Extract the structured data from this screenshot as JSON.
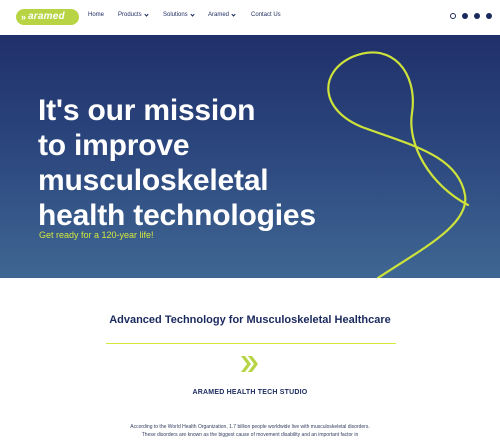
{
  "logo": {
    "text": "aramed",
    "chevrons": "»"
  },
  "nav": {
    "items": [
      {
        "label": "Home",
        "has_dropdown": false
      },
      {
        "label": "Products",
        "has_dropdown": true
      },
      {
        "label": "Solutions",
        "has_dropdown": true
      },
      {
        "label": "Aramed",
        "has_dropdown": true
      },
      {
        "label": "Contact Us",
        "has_dropdown": false
      }
    ],
    "icons": [
      "globe-icon",
      "facebook-icon",
      "linkedin-icon",
      "instagram-icon"
    ]
  },
  "hero": {
    "title_lines": [
      "It's our mission",
      "to improve",
      "musculoskeletal",
      "health technologies"
    ],
    "subtitle": "Get ready for a 120-year life!",
    "accent_color": "#d4e83c"
  },
  "main": {
    "section_title": "Advanced Technology for Musculoskeletal Healthcare",
    "studio_title": "ARAMED HEALTH TECH STUDIO",
    "body_lines": [
      "According to the World Health Organization, 1.7 billion people worldwide live with musculoskeletal disorders.",
      "These disorders are known as the biggest cause of movement disability and an important factor in"
    ]
  },
  "colors": {
    "brand_green": "#b8d445",
    "navy": "#1b2a5e",
    "hero_top": "#20306a",
    "hero_bottom": "#3f6793"
  }
}
